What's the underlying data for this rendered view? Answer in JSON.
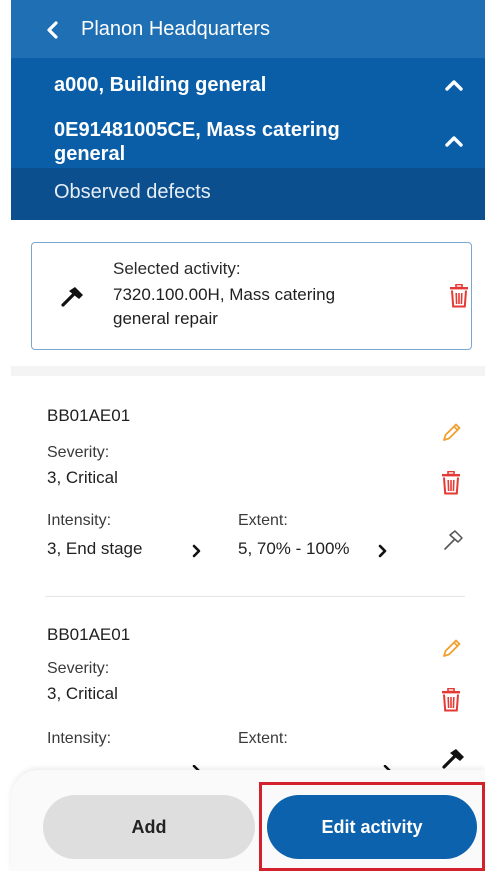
{
  "header": {
    "back_title": "Planon Headquarters",
    "level1_label": "a000, Building general",
    "level2_label": "0E91481005CE, Mass catering general",
    "level3_label": "Observed defects"
  },
  "activity": {
    "caption": "Selected activity:",
    "value": "7320.100.00H, Mass catering general repair"
  },
  "defects": [
    {
      "code": "BB01AE01",
      "severity_caption": "Severity:",
      "severity_value": "3, Critical",
      "intensity_caption": "Intensity:",
      "intensity_value": "3, End stage",
      "extent_caption": "Extent:",
      "extent_value": "5, 70% - 100%"
    },
    {
      "code": "BB01AE01",
      "severity_caption": "Severity:",
      "severity_value": "3, Critical",
      "intensity_caption": "Intensity:",
      "intensity_value": "",
      "extent_caption": "Extent:",
      "extent_value": ""
    }
  ],
  "actions": {
    "add_label": "Add",
    "edit_label": "Edit activity"
  },
  "colors": {
    "header_blue": "#0a5ea8",
    "delete_red": "#e53935",
    "edit_orange": "#f0a030",
    "primary_button": "#0c62ad"
  },
  "icons": [
    "chevron-left-icon",
    "chevron-up-icon",
    "hammer-icon",
    "trash-icon",
    "pencil-icon",
    "chevron-right-icon"
  ]
}
